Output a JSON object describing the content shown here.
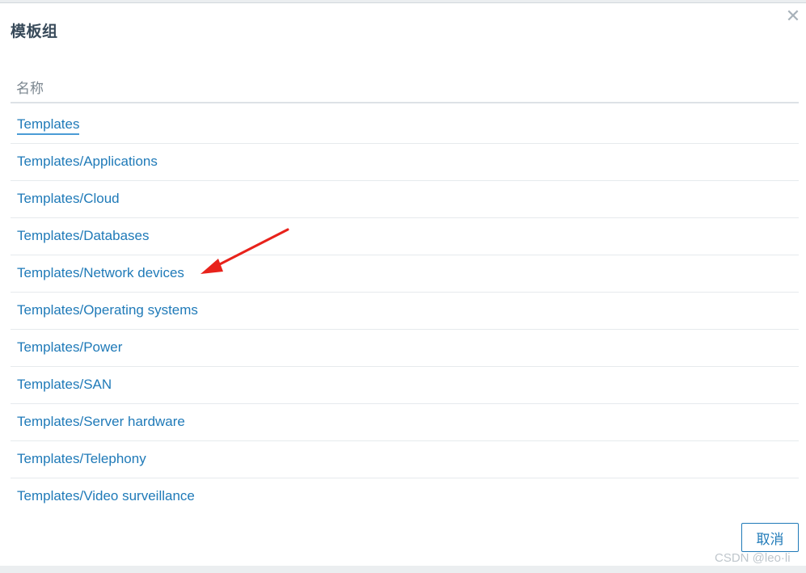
{
  "dialog": {
    "title": "模板组",
    "close_icon": "close-icon"
  },
  "table": {
    "header": "名称",
    "rows": [
      "Templates",
      "Templates/Applications",
      "Templates/Cloud",
      "Templates/Databases",
      "Templates/Network devices",
      "Templates/Operating systems",
      "Templates/Power",
      "Templates/SAN",
      "Templates/Server hardware",
      "Templates/Telephony",
      "Templates/Video surveillance"
    ]
  },
  "footer": {
    "cancel_label": "取消"
  },
  "watermark": "CSDN @leo·li",
  "colors": {
    "link": "#1f7ab8",
    "annotation_arrow": "#e8221b"
  }
}
